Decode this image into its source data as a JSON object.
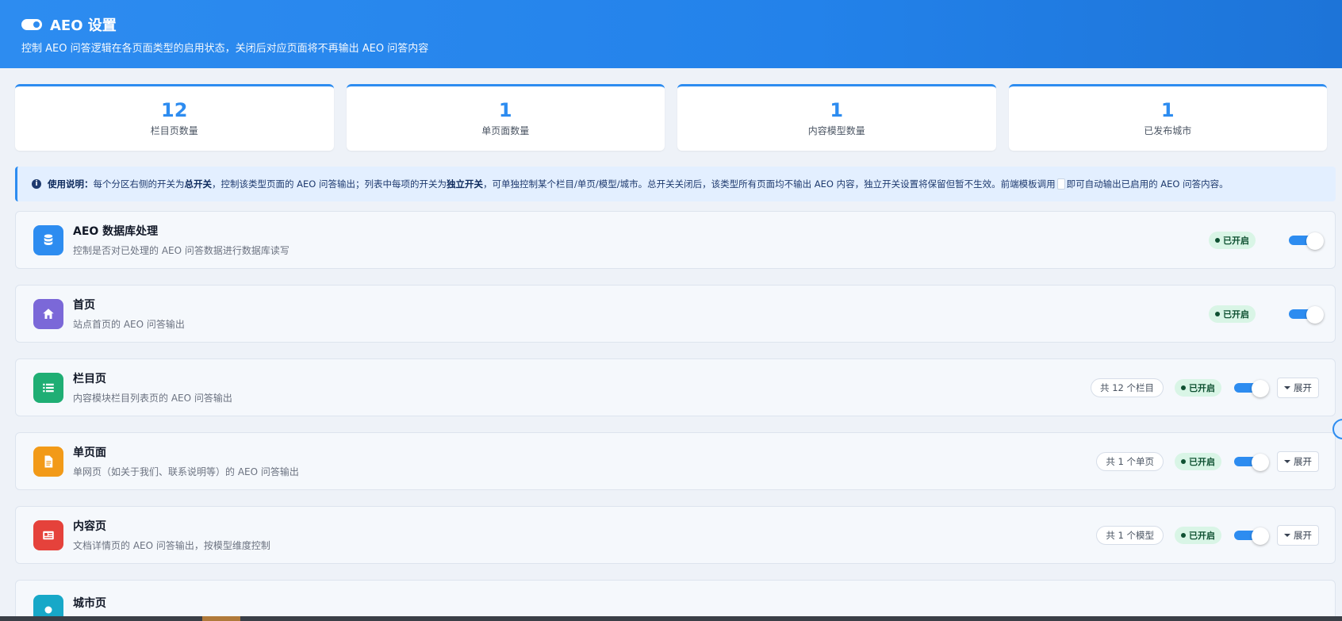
{
  "header": {
    "title": "AEO 设置",
    "subtitle": "控制 AEO 问答逻辑在各页面类型的启用状态，关闭后对应页面将不再输出 AEO 问答内容"
  },
  "stats": [
    {
      "value": "12",
      "label": "栏目页数量"
    },
    {
      "value": "1",
      "label": "单页面数量"
    },
    {
      "value": "1",
      "label": "内容模型数量"
    },
    {
      "value": "1",
      "label": "已发布城市"
    }
  ],
  "notice": {
    "lead": "使用说明：",
    "t1": "每个分区右侧的开关为",
    "b1": "总开关",
    "t2": "，控制该类型页面的 AEO 问答输出；列表中每项的开关为",
    "b2": "独立开关",
    "t3": "，可单独控制某个栏目/单页/模型/城市。总开关关闭后，该类型所有页面均不输出 AEO 内容，独立开关设置将保留但暂不生效。前端模板调用",
    "t4": "即可自动输出已启用的 AEO 问答内容。"
  },
  "sections": [
    {
      "title": "AEO 数据库处理",
      "desc": "控制是否对已处理的 AEO 问答数据进行数据库读写",
      "status": "已开启",
      "icon": "database-icon",
      "color": "#2d8cf0"
    },
    {
      "title": "首页",
      "desc": "站点首页的 AEO 问答输出",
      "status": "已开启",
      "icon": "home-icon",
      "color": "#7b68d8"
    },
    {
      "title": "栏目页",
      "desc": "内容模块栏目列表页的 AEO 问答输出",
      "status": "已开启",
      "count": "共 12 个栏目",
      "expand": "展开",
      "icon": "list-icon",
      "color": "#1fae74"
    },
    {
      "title": "单页面",
      "desc": "单网页（如关于我们、联系说明等）的 AEO 问答输出",
      "status": "已开启",
      "count": "共 1 个单页",
      "expand": "展开",
      "icon": "file-icon",
      "color": "#f29a18"
    },
    {
      "title": "内容页",
      "desc": "文档详情页的 AEO 问答输出，按模型维度控制",
      "status": "已开启",
      "count": "共 1 个模型",
      "expand": "展开",
      "icon": "newspaper-icon",
      "color": "#e5423b"
    },
    {
      "title": "城市页",
      "icon": "city-icon",
      "color": "#17a8c8"
    }
  ]
}
